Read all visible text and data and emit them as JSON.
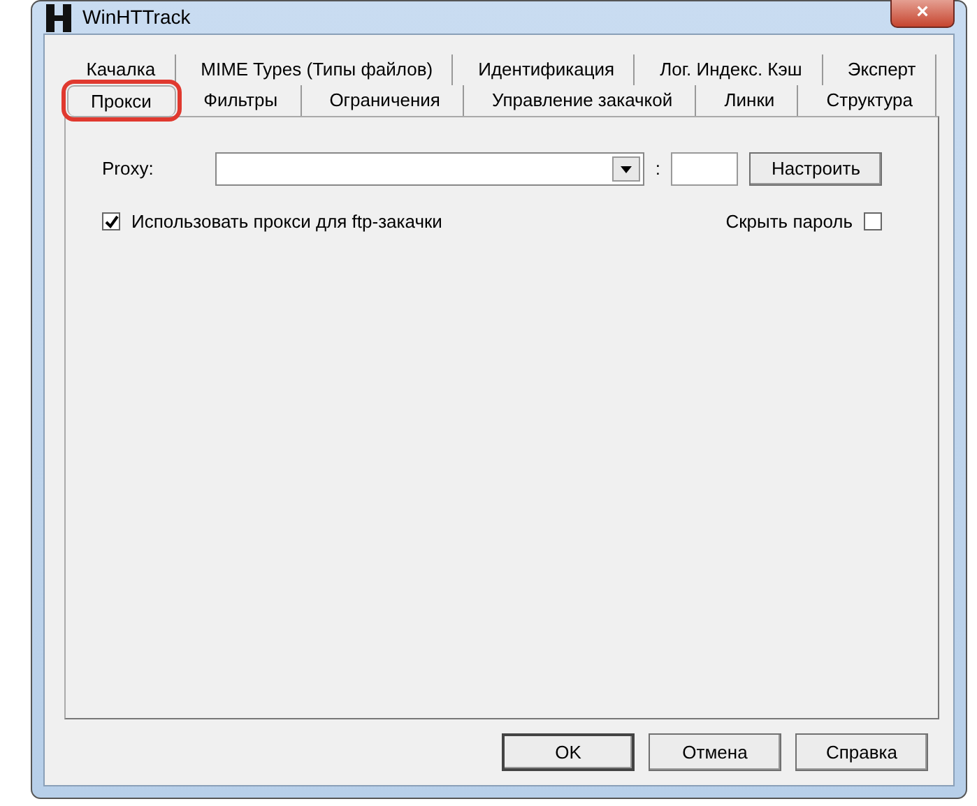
{
  "window": {
    "title": "WinHTTrack",
    "close": "×"
  },
  "tab_rows": [
    [
      {
        "label": "Качалка",
        "selected": false,
        "highlighted": false
      },
      {
        "label": "MIME Types (Типы файлов)",
        "selected": false,
        "highlighted": false
      },
      {
        "label": "Идентификация",
        "selected": false,
        "highlighted": false
      },
      {
        "label": "Лог. Индекс. Кэш",
        "selected": false,
        "highlighted": false
      },
      {
        "label": "Эксперт",
        "selected": false,
        "highlighted": false
      }
    ],
    [
      {
        "label": "Прокси",
        "selected": true,
        "highlighted": true
      },
      {
        "label": "Фильтры",
        "selected": false,
        "highlighted": false
      },
      {
        "label": "Ограничения",
        "selected": false,
        "highlighted": false
      },
      {
        "label": "Управление закачкой",
        "selected": false,
        "highlighted": false
      },
      {
        "label": "Линки",
        "selected": false,
        "highlighted": false
      },
      {
        "label": "Структура",
        "selected": false,
        "highlighted": false
      }
    ]
  ],
  "proxy": {
    "label": "Proxy:",
    "separator": ":",
    "configure_button": "Настроить"
  },
  "options": [
    {
      "label": "Использовать прокси для ftp-закачки",
      "checked": true,
      "kind": "leading"
    },
    {
      "label": "Скрыть пароль",
      "checked": false,
      "kind": "trailing"
    }
  ],
  "buttons": [
    {
      "label": "OK",
      "default": true
    },
    {
      "label": "Отмена",
      "default": false
    },
    {
      "label": "Справка",
      "default": false
    }
  ]
}
